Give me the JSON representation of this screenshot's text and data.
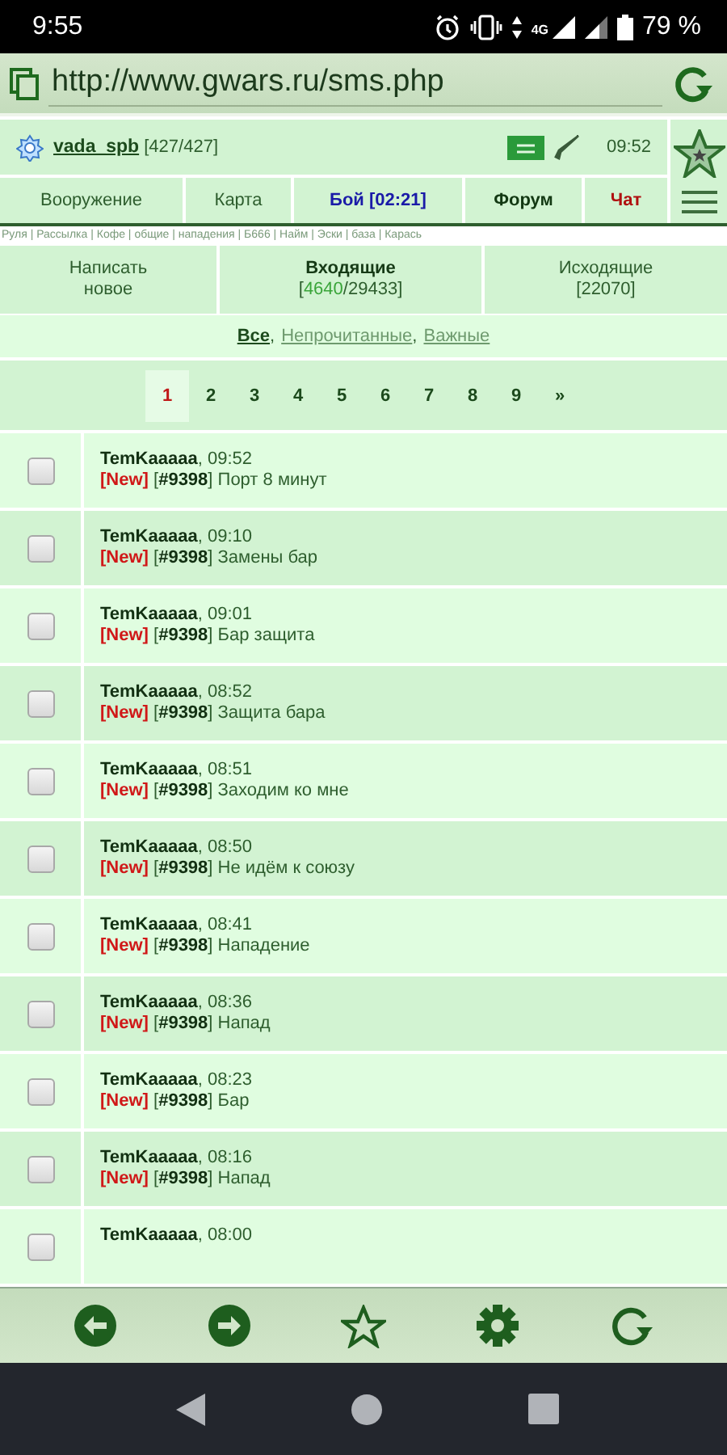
{
  "status_bar": {
    "time": "9:55",
    "network": "4G",
    "battery": "79 %"
  },
  "browser": {
    "url": "http://www.gwars.ru/sms.php"
  },
  "header": {
    "user": "vada_spb",
    "hp": "[427/427]",
    "time": "09:52"
  },
  "nav": [
    {
      "label": "Вооружение",
      "kind": "normal",
      "color": "#2e5e2e"
    },
    {
      "label": "Карта",
      "kind": "normal",
      "color": "#2e5e2e"
    },
    {
      "label": "Бой [02:21]",
      "kind": "strong",
      "color": "#1a1aa8"
    },
    {
      "label": "Форум",
      "kind": "strong",
      "color": "#123812"
    },
    {
      "label": "Чат",
      "kind": "strong",
      "color": "#b01010"
    }
  ],
  "quick_links": "Руля | Рассылка | Кофе | общие | нападения | Б666 | Найм | Эски | база | Карась",
  "mail_tabs": [
    {
      "label": "Написать",
      "sub": [
        {
          "text": "новое",
          "highlight": false
        }
      ],
      "selected": false
    },
    {
      "label": "Входящие",
      "sub": [
        {
          "text": "[",
          "highlight": false
        },
        {
          "text": "4640",
          "highlight": true
        },
        {
          "text": "/29433]",
          "highlight": false
        }
      ],
      "selected": true
    },
    {
      "label": "Исходящие",
      "sub": [
        {
          "text": "[22070]",
          "highlight": false
        }
      ],
      "selected": false
    }
  ],
  "filters": [
    {
      "label": "Все",
      "selected": true,
      "separator": ","
    },
    {
      "label": "Непрочитанные",
      "selected": false,
      "separator": ","
    },
    {
      "label": "Важные",
      "selected": false
    }
  ],
  "pages": [
    {
      "label": "1",
      "selected": true
    },
    {
      "label": "2",
      "selected": false
    },
    {
      "label": "3",
      "selected": false
    },
    {
      "label": "4",
      "selected": false
    },
    {
      "label": "5",
      "selected": false
    },
    {
      "label": "6",
      "selected": false
    },
    {
      "label": "7",
      "selected": false
    },
    {
      "label": "8",
      "selected": false
    },
    {
      "label": "9",
      "selected": false
    },
    {
      "label": "»",
      "selected": false
    }
  ],
  "messages": [
    {
      "checked": false,
      "from": "**TemKaaaaa**, 09:52",
      "tag": "[New]",
      "text": "[**#9398**] Порт 8 минут"
    },
    {
      "checked": false,
      "from": "**TemKaaaaa**, 09:10",
      "tag": "[New]",
      "text": "[**#9398**] Замены бар"
    },
    {
      "checked": false,
      "from": "**TemKaaaaa**, 09:01",
      "tag": "[New]",
      "text": "[**#9398**] Бар защита"
    },
    {
      "checked": false,
      "from": "**TemKaaaaa**, 08:52",
      "tag": "[New]",
      "text": "[**#9398**] Защита бара"
    },
    {
      "checked": false,
      "from": "**TemKaaaaa**, 08:51",
      "tag": "[New]",
      "text": "[**#9398**] Заходим ко мне"
    },
    {
      "checked": false,
      "from": "**TemKaaaaa**, 08:50",
      "tag": "[New]",
      "text": "[**#9398**] Не идём к союзу"
    },
    {
      "checked": false,
      "from": "**TemKaaaaa**, 08:41",
      "tag": "[New]",
      "text": "[**#9398**] Нападение"
    },
    {
      "checked": false,
      "from": "**TemKaaaaa**, 08:36",
      "tag": "[New]",
      "text": "[**#9398**] Напад"
    },
    {
      "checked": false,
      "from": "**TemKaaaaa**, 08:23",
      "tag": "[New]",
      "text": "[**#9398**] Бар"
    },
    {
      "checked": false,
      "from": "**TemKaaaaa**, 08:16",
      "tag": "[New]",
      "text": "[**#9398**] Напад"
    },
    {
      "checked": false,
      "from": "**TemKaaaaa**, 08:00"
    }
  ]
}
